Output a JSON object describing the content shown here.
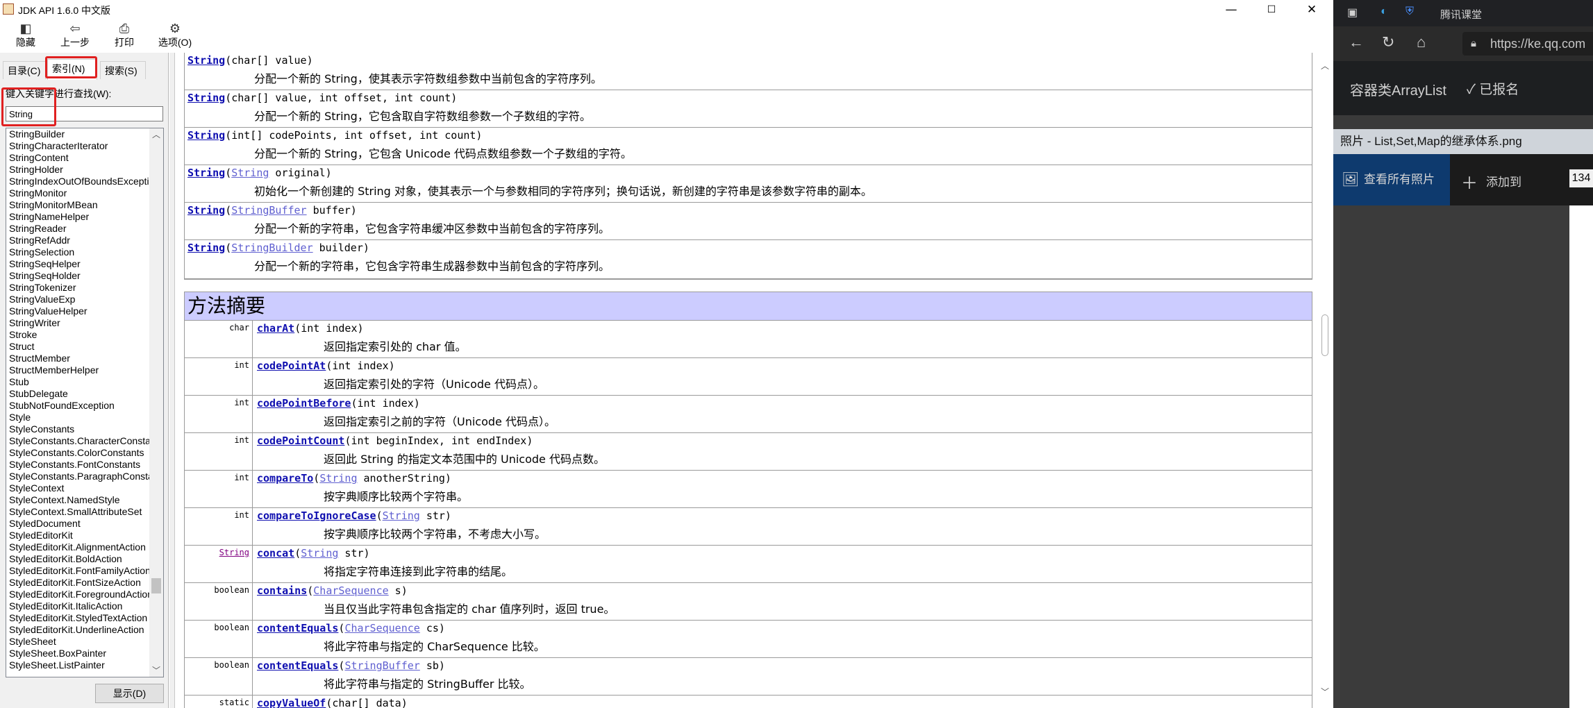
{
  "window": {
    "title": "JDK API 1.6.0 中文版",
    "minimize": "—",
    "maximize": "☐",
    "close": "✕"
  },
  "toolbar": {
    "hide": "隐藏",
    "back": "上一步",
    "print": "打印",
    "options": "选项(O)"
  },
  "left_pane": {
    "tabs": [
      "目录(C)",
      "索引(N)",
      "搜索(S)"
    ],
    "keyword_label": "键入关键字进行查找(W):",
    "search_value": "String",
    "display_button": "显示(D)",
    "index_items": [
      "StringBuilder",
      "StringCharacterIterator",
      "StringContent",
      "StringHolder",
      "StringIndexOutOfBoundsException",
      "StringMonitor",
      "StringMonitorMBean",
      "StringNameHelper",
      "StringReader",
      "StringRefAddr",
      "StringSelection",
      "StringSeqHelper",
      "StringSeqHolder",
      "StringTokenizer",
      "StringValueExp",
      "StringValueHelper",
      "StringWriter",
      "Stroke",
      "Struct",
      "StructMember",
      "StructMemberHelper",
      "Stub",
      "StubDelegate",
      "StubNotFoundException",
      "Style",
      "StyleConstants",
      "StyleConstants.CharacterConstants",
      "StyleConstants.ColorConstants",
      "StyleConstants.FontConstants",
      "StyleConstants.ParagraphConstants",
      "StyleContext",
      "StyleContext.NamedStyle",
      "StyleContext.SmallAttributeSet",
      "StyledDocument",
      "StyledEditorKit",
      "StyledEditorKit.AlignmentAction",
      "StyledEditorKit.BoldAction",
      "StyledEditorKit.FontFamilyAction",
      "StyledEditorKit.FontSizeAction",
      "StyledEditorKit.ForegroundAction",
      "StyledEditorKit.ItalicAction",
      "StyledEditorKit.StyledTextAction",
      "StyledEditorKit.UnderlineAction",
      "StyleSheet",
      "StyleSheet.BoxPainter",
      "StyleSheet.ListPainter"
    ]
  },
  "constructors": [
    {
      "name": "String",
      "params_pre": "(char[] value)",
      "desc": "分配一个新的 String，使其表示字符数组参数中当前包含的字符序列。"
    },
    {
      "name": "String",
      "params_pre": "(char[] value, int offset, int count)",
      "desc": "分配一个新的 String，它包含取自字符数组参数一个子数组的字符。"
    },
    {
      "name": "String",
      "params_pre": "(int[] codePoints, int offset, int count)",
      "desc": "分配一个新的 String，它包含 Unicode 代码点数组参数一个子数组的字符。"
    },
    {
      "name": "String",
      "params_pre": "(",
      "type_link": "String",
      "params_post": " original)",
      "desc": "初始化一个新创建的 String 对象，使其表示一个与参数相同的字符序列；换句话说，新创建的字符串是该参数字符串的副本。"
    },
    {
      "name": "String",
      "params_pre": "(",
      "type_link": "StringBuffer",
      "params_post": " buffer)",
      "desc": "分配一个新的字符串，它包含字符串缓冲区参数中当前包含的字符序列。"
    },
    {
      "name": "String",
      "params_pre": "(",
      "type_link": "StringBuilder",
      "params_post": " builder)",
      "desc": "分配一个新的字符串，它包含字符串生成器参数中当前包含的字符序列。"
    }
  ],
  "method_summary_title": "方法摘要",
  "methods": [
    {
      "rtype": "char",
      "name": "charAt",
      "params_pre": "(int index)",
      "desc": "返回指定索引处的 char 值。"
    },
    {
      "rtype": "int",
      "name": "codePointAt",
      "params_pre": "(int index)",
      "desc": "返回指定索引处的字符（Unicode 代码点）。"
    },
    {
      "rtype": "int",
      "name": "codePointBefore",
      "params_pre": "(int index)",
      "desc": "返回指定索引之前的字符（Unicode 代码点）。"
    },
    {
      "rtype": "int",
      "name": "codePointCount",
      "params_pre": "(int beginIndex, int endIndex)",
      "desc": "返回此 String 的指定文本范围中的 Unicode 代码点数。"
    },
    {
      "rtype": "int",
      "name": "compareTo",
      "params_pre": "(",
      "type_link": "String",
      "params_post": " anotherString)",
      "desc": "按字典顺序比较两个字符串。"
    },
    {
      "rtype": "int",
      "name": "compareToIgnoreCase",
      "params_pre": "(",
      "type_link": "String",
      "params_post": " str)",
      "desc": "按字典顺序比较两个字符串，不考虑大小写。"
    },
    {
      "rtype": "String",
      "rtype_link": true,
      "name": "concat",
      "params_pre": "(",
      "type_link": "String",
      "params_post": " str)",
      "desc": "将指定字符串连接到此字符串的结尾。"
    },
    {
      "rtype": "boolean",
      "name": "contains",
      "params_pre": "(",
      "type_link": "CharSequence",
      "params_post": " s)",
      "desc": "当且仅当此字符串包含指定的 char 值序列时，返回 true。"
    },
    {
      "rtype": "boolean",
      "name": "contentEquals",
      "params_pre": "(",
      "type_link": "CharSequence",
      "params_post": " cs)",
      "desc": "将此字符串与指定的 CharSequence 比较。"
    },
    {
      "rtype": "boolean",
      "name": "contentEquals",
      "params_pre": "(",
      "type_link": "StringBuffer",
      "params_post": " sb)",
      "desc": "将此字符串与指定的 StringBuffer 比较。"
    },
    {
      "rtype": "static String",
      "name": "copyValueOf",
      "params_pre": "(char[] data)",
      "desc": ""
    }
  ],
  "browser": {
    "tab_title": "腾讯课堂",
    "url": "https://ke.qq.com",
    "course_title": "容器类ArrayList",
    "enrolled": "✓ 已报名",
    "photo_title": "照片 - List,Set,Map的继承体系.png",
    "view_all": "查看所有照片",
    "add_to": "添加到",
    "corner_number": "134"
  },
  "colors": {
    "link": "#0f0fb0",
    "type_link": "#5f5fd0",
    "method_header_bg": "#ccccff",
    "highlight_box": "#e02020"
  }
}
